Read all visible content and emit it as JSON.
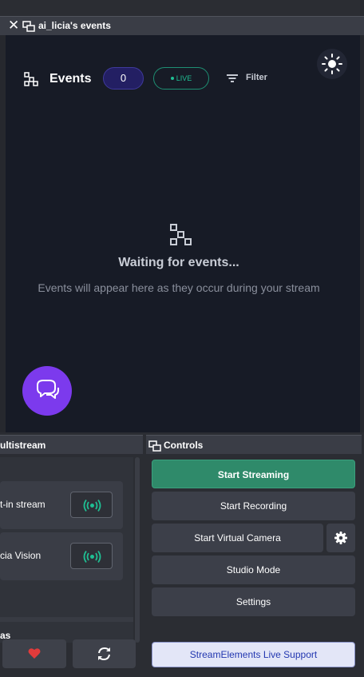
{
  "dock_events": {
    "title": "ai_licia's events",
    "header_label": "Events",
    "count": "0",
    "live_label": "LIVE",
    "filter_label": "Filter",
    "empty_title": "Waiting for events...",
    "empty_subtitle": "Events will appear here as they occur during your stream"
  },
  "dock_multistream": {
    "title": "ultistream",
    "rows": [
      {
        "label": "t-in stream"
      },
      {
        "label": "cia Vision"
      }
    ],
    "section_label": "as",
    "button_icons": [
      "heart-icon",
      "refresh-icon"
    ]
  },
  "dock_controls": {
    "title": "Controls",
    "start_streaming": "Start Streaming",
    "start_recording": "Start Recording",
    "start_virtual_camera": "Start Virtual Camera",
    "studio_mode": "Studio Mode",
    "settings": "Settings",
    "support": "StreamElements Live Support"
  },
  "colors": {
    "events_bg": "#171b26",
    "accent_purple": "#7c3aed",
    "live_green": "#1fbf93",
    "primary_green": "#2f8a6a"
  }
}
